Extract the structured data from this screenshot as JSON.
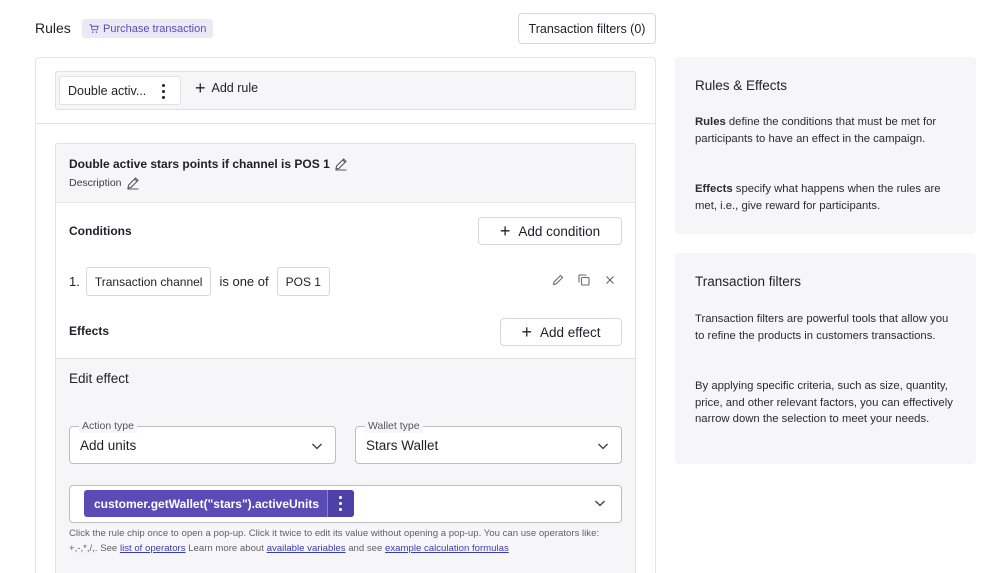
{
  "header": {
    "title": "Rules",
    "badge": "Purchase transaction",
    "transaction_filters_button": "Transaction filters (0)"
  },
  "rule_tabs": {
    "active_tab": "Double activ...",
    "add_rule": "Add rule"
  },
  "rule": {
    "name": "Double active stars points if channel is POS 1",
    "description_label": "Description",
    "conditions_label": "Conditions",
    "add_condition": "Add condition",
    "condition": {
      "index": "1.",
      "field": "Transaction channel",
      "operator": "is one of",
      "value": "POS 1"
    },
    "effects_label": "Effects",
    "add_effect": "Add effect"
  },
  "edit_effect": {
    "title": "Edit effect",
    "action_type": {
      "label": "Action type",
      "value": "Add units"
    },
    "wallet_type": {
      "label": "Wallet type",
      "value": "Stars Wallet"
    },
    "formula_chip": "customer.getWallet(\"stars\").activeUnits",
    "help": {
      "part1": "Click the rule chip once to open a pop-up. Click it twice to edit its value without opening a pop-up. You can use operators like: +,-,*,/,. See ",
      "link_operators": "list of operators",
      "part2": " Learn more about ",
      "link_variables": "available variables",
      "part3": " and see ",
      "link_formulas": "example calculation formulas"
    }
  },
  "info_panels": {
    "rules_effects": {
      "title": "Rules & Effects",
      "rules_term": "Rules",
      "rules_text": " define the conditions that must be met for participants to have an effect in the campaign.",
      "effects_term": "Effects",
      "effects_text": " specify what happens when the rules are met, i.e., give reward for participants."
    },
    "transaction_filters": {
      "title": "Transaction filters",
      "para1": "Transaction filters are powerful tools that allow you to refine the products in customers transactions.",
      "para2": "By applying specific criteria, such as size, quantity, price, and other relevant factors, you can effectively narrow down the selection to meet your needs."
    }
  },
  "colors": {
    "accent": "#5a4bb6",
    "badge_bg": "#ece9f7",
    "panel_bg": "#f6f6f9",
    "link": "#3b3bb0"
  },
  "icons": [
    "cart-icon",
    "pencil-icon",
    "plus-icon",
    "kebab-icon",
    "copy-icon",
    "close-icon",
    "chevron-down-icon"
  ]
}
